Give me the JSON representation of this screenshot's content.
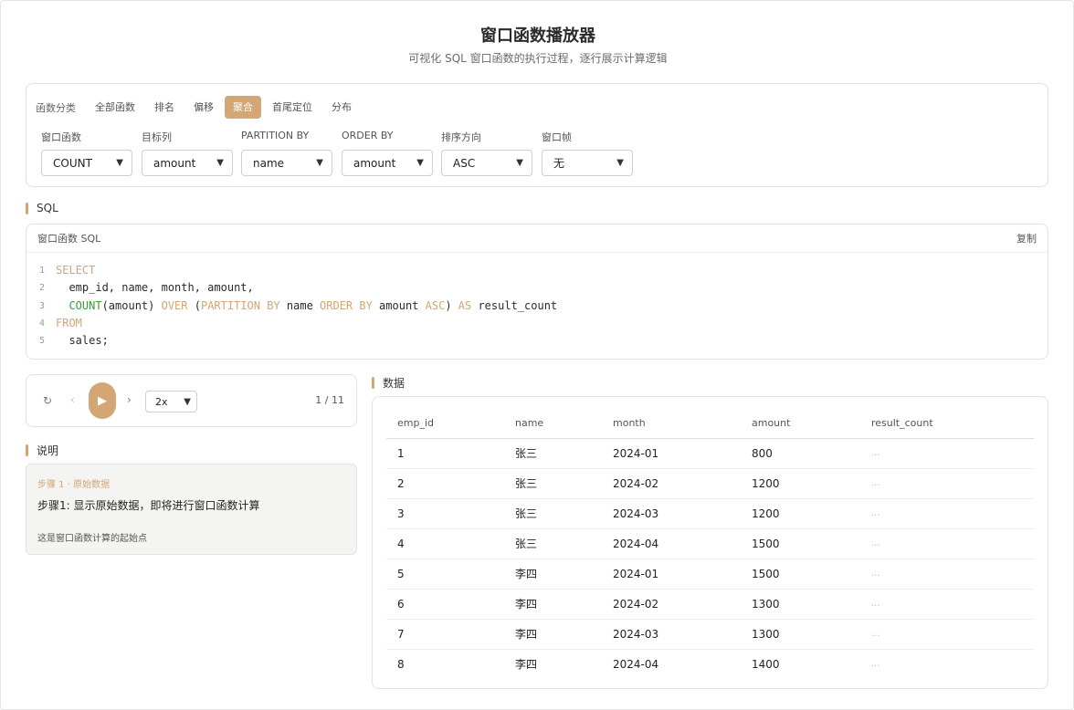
{
  "header": {
    "title": "窗口函数播放器",
    "subtitle": "可视化 SQL 窗口函数的执行过程，逐行展示计算逻辑"
  },
  "controls": {
    "category_label": "函数分类",
    "categories": [
      "全部函数",
      "排名",
      "偏移",
      "聚合",
      "首尾定位",
      "分布"
    ],
    "active_category": "聚合",
    "fields": [
      {
        "label": "窗口函数",
        "value": "COUNT"
      },
      {
        "label": "目标列",
        "value": "amount"
      },
      {
        "label": "PARTITION BY",
        "value": "name"
      },
      {
        "label": "ORDER BY",
        "value": "amount"
      },
      {
        "label": "排序方向",
        "value": "ASC"
      },
      {
        "label": "窗口帧",
        "value": "无"
      }
    ]
  },
  "sql_section": {
    "heading": "SQL",
    "panel_title": "窗口函数 SQL",
    "copy_label": "复制",
    "line_numbers": [
      "1",
      "2",
      "3",
      "4",
      "5"
    ],
    "lines": [
      "SELECT",
      "  emp_id, name, month, amount,",
      "  COUNT(amount) OVER (PARTITION BY name ORDER BY amount ASC) AS result_count",
      "FROM",
      "  sales;"
    ]
  },
  "player": {
    "reset_icon": "↻",
    "prev_icon": "‹",
    "play_icon": "▶",
    "next_icon": "›",
    "speed": "2x",
    "step_counter": "1 / 11"
  },
  "explanation": {
    "heading": "说明",
    "step_title": "步骤 1 · 原始数据",
    "main_text": "步骤1: 显示原始数据，即将进行窗口函数计算",
    "note": "这是窗口函数计算的起始点"
  },
  "data_section": {
    "heading": "数据",
    "columns": [
      "emp_id",
      "name",
      "month",
      "amount",
      "result_count"
    ],
    "rows": [
      [
        "1",
        "张三",
        "2024-01",
        "800",
        "..."
      ],
      [
        "2",
        "张三",
        "2024-02",
        "1200",
        "..."
      ],
      [
        "3",
        "张三",
        "2024-03",
        "1200",
        "..."
      ],
      [
        "4",
        "张三",
        "2024-04",
        "1500",
        "..."
      ],
      [
        "5",
        "李四",
        "2024-01",
        "1500",
        "..."
      ],
      [
        "6",
        "李四",
        "2024-02",
        "1300",
        "..."
      ],
      [
        "7",
        "李四",
        "2024-03",
        "1300",
        "..."
      ],
      [
        "8",
        "李四",
        "2024-04",
        "1400",
        "..."
      ]
    ]
  },
  "colors": {
    "accent": "#d4a575",
    "function_green": "#3a9a3a"
  }
}
